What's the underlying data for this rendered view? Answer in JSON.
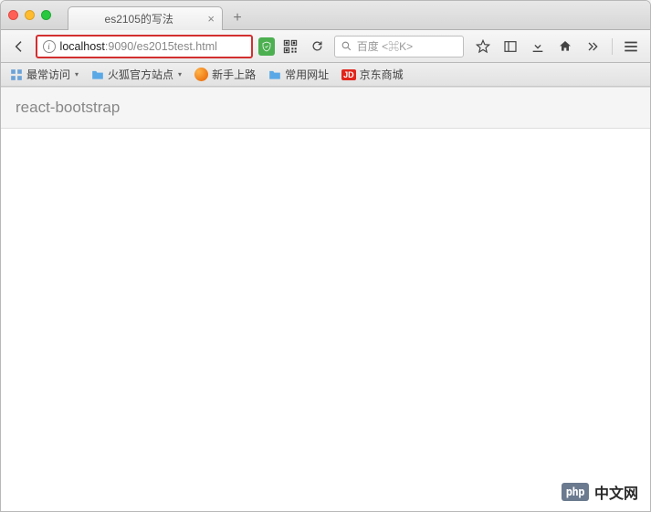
{
  "tabs": [
    {
      "title": "es2105的写法"
    }
  ],
  "url": {
    "host": "localhost",
    "rest": ":9090/es2015test.html"
  },
  "search": {
    "placeholder": "百度 <⌘K>"
  },
  "bookmarks": {
    "most_visited": "最常访问",
    "firefox_official": "火狐官方站点",
    "getting_started": "新手上路",
    "common_urls": "常用网址",
    "jd_mall": "京东商城"
  },
  "page": {
    "panel_title": "react-bootstrap"
  },
  "watermark": {
    "logo": "php",
    "text": "中文网"
  }
}
